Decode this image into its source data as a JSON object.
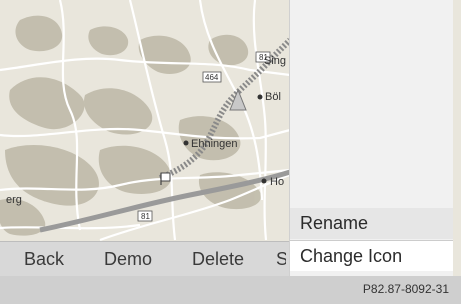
{
  "map": {
    "places": [
      "Sing",
      "Böl",
      "Ehningen",
      "Ho",
      "erg"
    ],
    "road_labels": [
      "464",
      "81",
      "81"
    ]
  },
  "side_menu": {
    "items": [
      {
        "label": "Rename"
      },
      {
        "label": "Change Icon"
      }
    ]
  },
  "bottom_bar": {
    "back_label": "Back",
    "demo_label": "Demo",
    "delete_label": "Delete",
    "cut_label": "S"
  },
  "footer": {
    "figure_code": "P82.87-8092-31"
  },
  "colors": {
    "map_background": "#e9e6dc",
    "forest": "#b8b3a3",
    "road": "#ffffff",
    "route": "#8e8e8e"
  }
}
